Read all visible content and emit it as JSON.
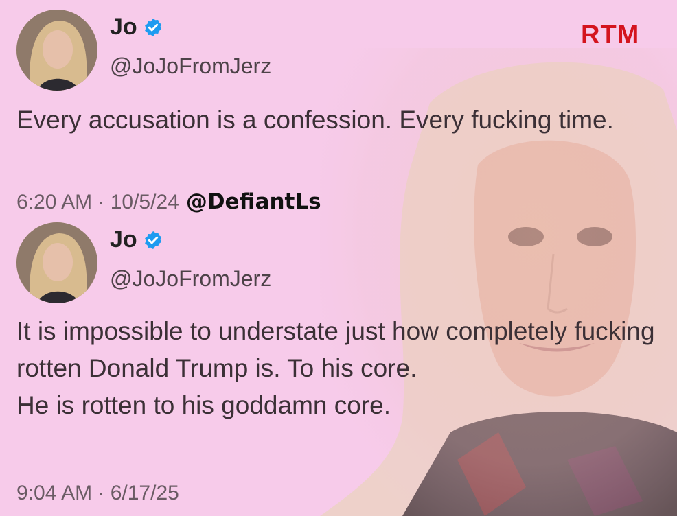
{
  "brand": {
    "logo_text": "RTM",
    "color": "#d4141e"
  },
  "background_color": "#f7cbea",
  "tweets": [
    {
      "display_name": "Jo",
      "handle": "@JoJoFromJerz",
      "verified_icon": "verified-badge-icon",
      "text": "Every accusation is a confession. Every fucking time.",
      "time": "6:20 AM · 10/5/24",
      "credit": "@DefiantLs"
    },
    {
      "display_name": "Jo",
      "handle": "@JoJoFromJerz",
      "verified_icon": "verified-badge-icon",
      "text_line1": "It is impossible to understate just how completely fucking rotten Donald Trump is. To his core.",
      "text_line2": "He is rotten to his goddamn core.",
      "time": "9:04 AM · 6/17/25"
    }
  ]
}
